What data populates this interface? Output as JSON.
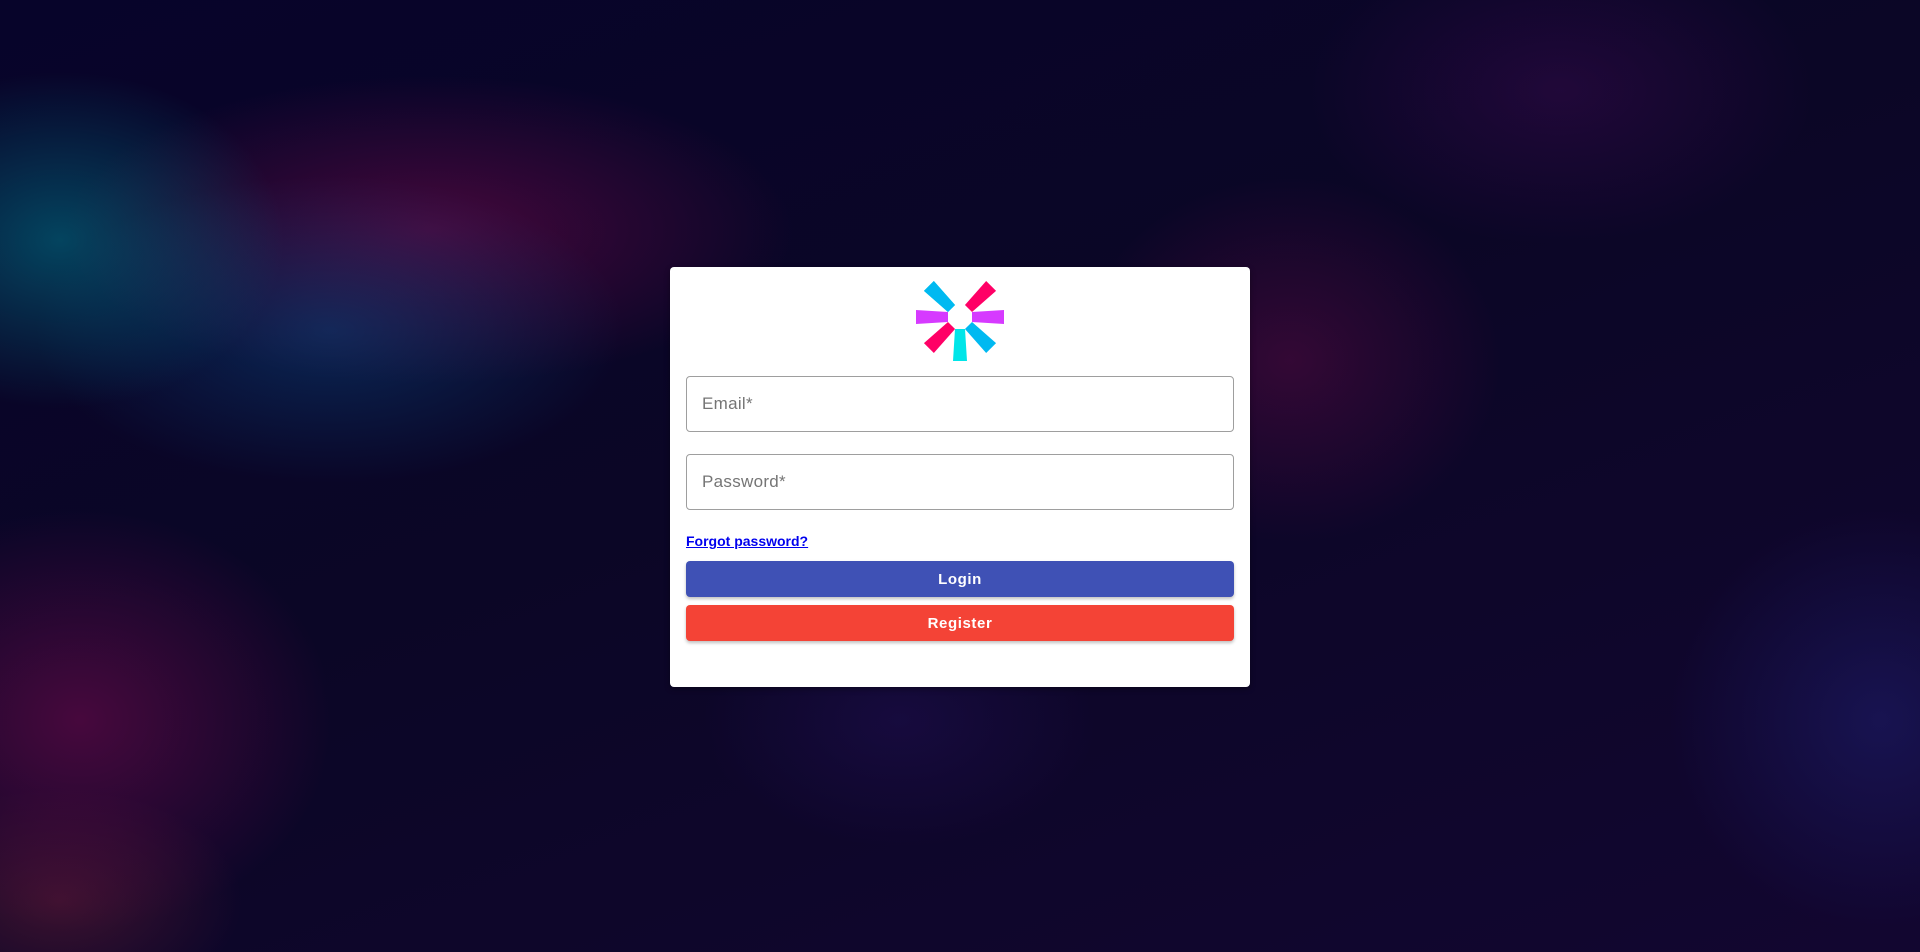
{
  "logo": {
    "icon": "jwt-logo-icon",
    "colors": [
      "#00e5e8",
      "#ff0066",
      "#d63aff",
      "#00b9f1"
    ]
  },
  "form": {
    "email_placeholder": "Email*",
    "password_placeholder": "Password*",
    "forgot_password_label": "Forgot password?",
    "login_label": "Login",
    "register_label": "Register"
  },
  "colors": {
    "login_button": "#3f51b5",
    "register_button": "#f44336",
    "link": "#0000ee"
  }
}
